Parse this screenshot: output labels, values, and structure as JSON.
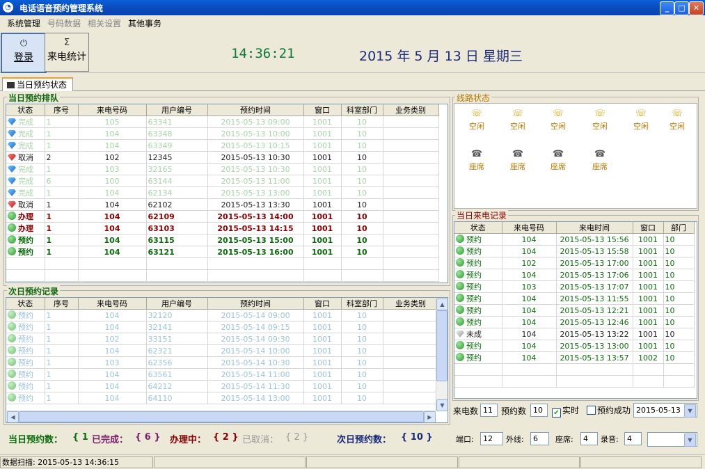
{
  "window": {
    "title": "电话语音预约管理系统",
    "min": "_",
    "max": "□",
    "close": "✕"
  },
  "menu": [
    "系统管理",
    "号码数据",
    "相关设置",
    "其他事务"
  ],
  "toolbar": {
    "login_label": "登录",
    "stats_label": "来电统计",
    "stats_icon": "Σ",
    "time": "14:36:21",
    "date": "2015 年 5 月 13 日 星期三"
  },
  "tab": {
    "label": "当日预约状态"
  },
  "today_queue": {
    "title": "当日预约排队",
    "columns": [
      "状态",
      "序号",
      "来电号码",
      "用户编号",
      "预约时间",
      "窗口",
      "科室部门",
      "业务类别"
    ],
    "rows": [
      {
        "icon": "diamond-blue",
        "status": "完成",
        "seq": "1",
        "phone": "105",
        "user": "63341",
        "time": "2015-05-13 09:00",
        "win": "1001",
        "dept": "10",
        "cat": "",
        "cls": "r-done"
      },
      {
        "icon": "diamond-blue",
        "status": "完成",
        "seq": "1",
        "phone": "104",
        "user": "63348",
        "time": "2015-05-13 10:00",
        "win": "1001",
        "dept": "10",
        "cat": "",
        "cls": "r-done"
      },
      {
        "icon": "diamond-blue",
        "status": "完成",
        "seq": "1",
        "phone": "104",
        "user": "63349",
        "time": "2015-05-13 10:15",
        "win": "1001",
        "dept": "10",
        "cat": "",
        "cls": "r-done"
      },
      {
        "icon": "diamond-red",
        "status": "取消",
        "seq": "2",
        "phone": "102",
        "user": "12345",
        "time": "2015-05-13 10:30",
        "win": "1001",
        "dept": "10",
        "cat": "",
        "cls": "r-cancel"
      },
      {
        "icon": "diamond-blue",
        "status": "完成",
        "seq": "1",
        "phone": "103",
        "user": "32165",
        "time": "2015-05-13 10:30",
        "win": "1001",
        "dept": "10",
        "cat": "",
        "cls": "r-done"
      },
      {
        "icon": "diamond-blue",
        "status": "完成",
        "seq": "6",
        "phone": "100",
        "user": "63144",
        "time": "2015-05-13 11:00",
        "win": "1001",
        "dept": "10",
        "cat": "",
        "cls": "r-done"
      },
      {
        "icon": "diamond-blue",
        "status": "完成",
        "seq": "1",
        "phone": "104",
        "user": "62134",
        "time": "2015-05-13 13:00",
        "win": "1001",
        "dept": "10",
        "cat": "",
        "cls": "r-done"
      },
      {
        "icon": "diamond-red",
        "status": "取消",
        "seq": "1",
        "phone": "104",
        "user": "62102",
        "time": "2015-05-13 13:30",
        "win": "1001",
        "dept": "10",
        "cat": "",
        "cls": "r-cancel"
      },
      {
        "icon": "circle-green",
        "status": "办理",
        "seq": "1",
        "phone": "104",
        "user": "62109",
        "time": "2015-05-13 14:00",
        "win": "1001",
        "dept": "10",
        "cat": "",
        "cls": "r-proc"
      },
      {
        "icon": "circle-green",
        "status": "办理",
        "seq": "1",
        "phone": "104",
        "user": "63103",
        "time": "2015-05-13 14:15",
        "win": "1001",
        "dept": "10",
        "cat": "",
        "cls": "r-proc"
      },
      {
        "icon": "circle-green",
        "status": "预约",
        "seq": "1",
        "phone": "104",
        "user": "63115",
        "time": "2015-05-13 15:00",
        "win": "1001",
        "dept": "10",
        "cat": "",
        "cls": "r-book"
      },
      {
        "icon": "circle-green",
        "status": "预约",
        "seq": "1",
        "phone": "104",
        "user": "63121",
        "time": "2015-05-13 16:00",
        "win": "1001",
        "dept": "10",
        "cat": "",
        "cls": "r-book"
      }
    ]
  },
  "next_day": {
    "title": "次日预约记录",
    "columns": [
      "状态",
      "序号",
      "来电号码",
      "用户编号",
      "预约时间",
      "窗口",
      "科室部门",
      "业务类别"
    ],
    "rows": [
      {
        "icon": "circle-lgreen",
        "status": "预约",
        "seq": "1",
        "phone": "104",
        "user": "32120",
        "time": "2015-05-14 09:00",
        "win": "1001",
        "dept": "10",
        "cat": "",
        "cls": "r-next"
      },
      {
        "icon": "circle-lgreen",
        "status": "预约",
        "seq": "1",
        "phone": "104",
        "user": "32141",
        "time": "2015-05-14 09:15",
        "win": "1001",
        "dept": "10",
        "cat": "",
        "cls": "r-next"
      },
      {
        "icon": "circle-lgreen",
        "status": "预约",
        "seq": "1",
        "phone": "102",
        "user": "33151",
        "time": "2015-05-14 09:30",
        "win": "1001",
        "dept": "10",
        "cat": "",
        "cls": "r-next"
      },
      {
        "icon": "circle-lgreen",
        "status": "预约",
        "seq": "1",
        "phone": "104",
        "user": "62321",
        "time": "2015-05-14 10:00",
        "win": "1001",
        "dept": "10",
        "cat": "",
        "cls": "r-next"
      },
      {
        "icon": "circle-lgreen",
        "status": "预约",
        "seq": "1",
        "phone": "103",
        "user": "62356",
        "time": "2015-05-14 10:30",
        "win": "1001",
        "dept": "10",
        "cat": "",
        "cls": "r-next"
      },
      {
        "icon": "circle-lgreen",
        "status": "预约",
        "seq": "1",
        "phone": "104",
        "user": "63561",
        "time": "2015-05-14 11:00",
        "win": "1001",
        "dept": "10",
        "cat": "",
        "cls": "r-next"
      },
      {
        "icon": "circle-lgreen",
        "status": "预约",
        "seq": "1",
        "phone": "104",
        "user": "64212",
        "time": "2015-05-14 11:30",
        "win": "1001",
        "dept": "10",
        "cat": "",
        "cls": "r-next"
      },
      {
        "icon": "circle-lgreen",
        "status": "预约",
        "seq": "1",
        "phone": "104",
        "user": "64110",
        "time": "2015-05-14 13:00",
        "win": "1001",
        "dept": "10",
        "cat": "",
        "cls": "r-next"
      }
    ]
  },
  "summary": {
    "today_label": "当日预约数：",
    "today_value": "{ 1",
    "done_label": "已完成：",
    "done_value": "{ 6 }",
    "proc_label": "办理中：",
    "proc_value": "{ 2 }",
    "cancel_label": "已取消：",
    "cancel_value": "{ 2 }",
    "next_label": "次日预约数：",
    "next_value": "{ 10 }"
  },
  "lines": {
    "title": "线路状态",
    "outer": [
      "空闲",
      "空闲",
      "空闲",
      "空闲",
      "空闲",
      "空闲"
    ],
    "seats": [
      "座席",
      "座席",
      "座席",
      "座席"
    ]
  },
  "calls": {
    "title": "当日来电记录",
    "columns": [
      "状态",
      "来电号码",
      "来电时间",
      "窗口",
      "部门"
    ],
    "rows": [
      {
        "icon": "circle-green",
        "status": "预约",
        "phone": "104",
        "time": "2015-05-13 15:56",
        "win": "1001",
        "dept": "10",
        "cls": "r-call"
      },
      {
        "icon": "circle-green",
        "status": "预约",
        "phone": "104",
        "time": "2015-05-13 15:58",
        "win": "1001",
        "dept": "10",
        "cls": "r-call"
      },
      {
        "icon": "circle-green",
        "status": "预约",
        "phone": "102",
        "time": "2015-05-13 17:00",
        "win": "1001",
        "dept": "10",
        "cls": "r-call"
      },
      {
        "icon": "circle-green",
        "status": "预约",
        "phone": "104",
        "time": "2015-05-13 17:06",
        "win": "1001",
        "dept": "10",
        "cls": "r-call"
      },
      {
        "icon": "circle-green",
        "status": "预约",
        "phone": "103",
        "time": "2015-05-13 17:07",
        "win": "1001",
        "dept": "10",
        "cls": "r-call"
      },
      {
        "icon": "circle-green",
        "status": "预约",
        "phone": "104",
        "time": "2015-05-13 11:55",
        "win": "1001",
        "dept": "10",
        "cls": "r-call"
      },
      {
        "icon": "circle-green",
        "status": "预约",
        "phone": "104",
        "time": "2015-05-13 12:21",
        "win": "1001",
        "dept": "10",
        "cls": "r-call"
      },
      {
        "icon": "circle-green",
        "status": "预约",
        "phone": "104",
        "time": "2015-05-13 12:46",
        "win": "1001",
        "dept": "10",
        "cls": "r-call"
      },
      {
        "icon": "diamond-gray",
        "status": "未成",
        "phone": "104",
        "time": "2015-05-13 13:22",
        "win": "1001",
        "dept": "10",
        "cls": "r-miss"
      },
      {
        "icon": "circle-green",
        "status": "预约",
        "phone": "104",
        "time": "2015-05-13 13:00",
        "win": "1001",
        "dept": "10",
        "cls": "r-call"
      },
      {
        "icon": "circle-green",
        "status": "预约",
        "phone": "104",
        "time": "2015-05-13 13:57",
        "win": "1002",
        "dept": "10",
        "cls": "r-call"
      }
    ]
  },
  "call_filters": {
    "count_label": "来电数",
    "count_value": "11",
    "booked_label": "预约数",
    "booked_value": "10",
    "realtime_label": "实时",
    "success_label": "预约成功",
    "date_value": "2015-05-13"
  },
  "ports": {
    "port_label": "端口:",
    "port_value": "12",
    "outer_label": "外线:",
    "outer_value": "6",
    "seat_label": "座席:",
    "seat_value": "4",
    "rec_label": "录音:",
    "rec_value": "4",
    "combo_value": ""
  },
  "statusbar": {
    "text": "数据扫描: 2015-05-13 14:36:15"
  }
}
